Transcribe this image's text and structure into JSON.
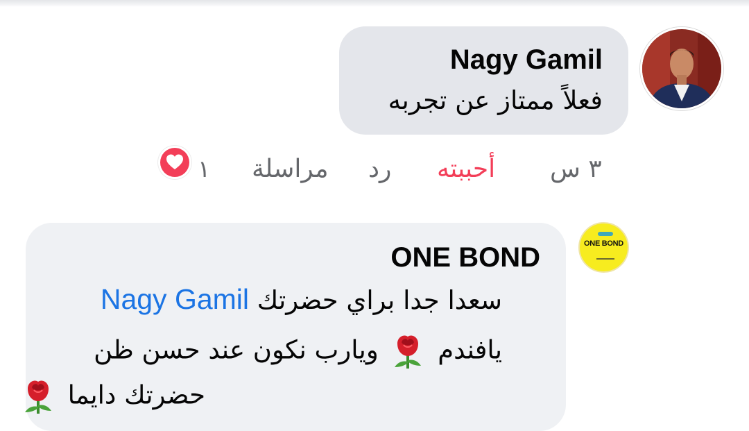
{
  "comments": [
    {
      "author": "Nagy Gamil",
      "text": "فعلاً ممتاز عن تجربه",
      "actions": {
        "time": "٣ س",
        "like": "أحببته",
        "reply": "رد",
        "message": "مراسلة"
      },
      "reaction": {
        "count": "١",
        "icon": "heart-icon",
        "color": "#f33e58"
      }
    },
    {
      "author": "ONE BOND",
      "avatar_text": "ONE BOND",
      "mention": "Nagy Gamil",
      "lines": [
        "سعدا جدا براي حضرتك",
        "يافندم",
        "ويارب نكون عند حسن ظن",
        "حضرتك دايما"
      ],
      "emoji": "rose-icon"
    }
  ],
  "colors": {
    "bubble": "#e4e6eb",
    "bubble_alt": "#eff1f4",
    "like_active": "#f33e58",
    "mention": "#1b74e4",
    "secondary_text": "#65676b"
  }
}
